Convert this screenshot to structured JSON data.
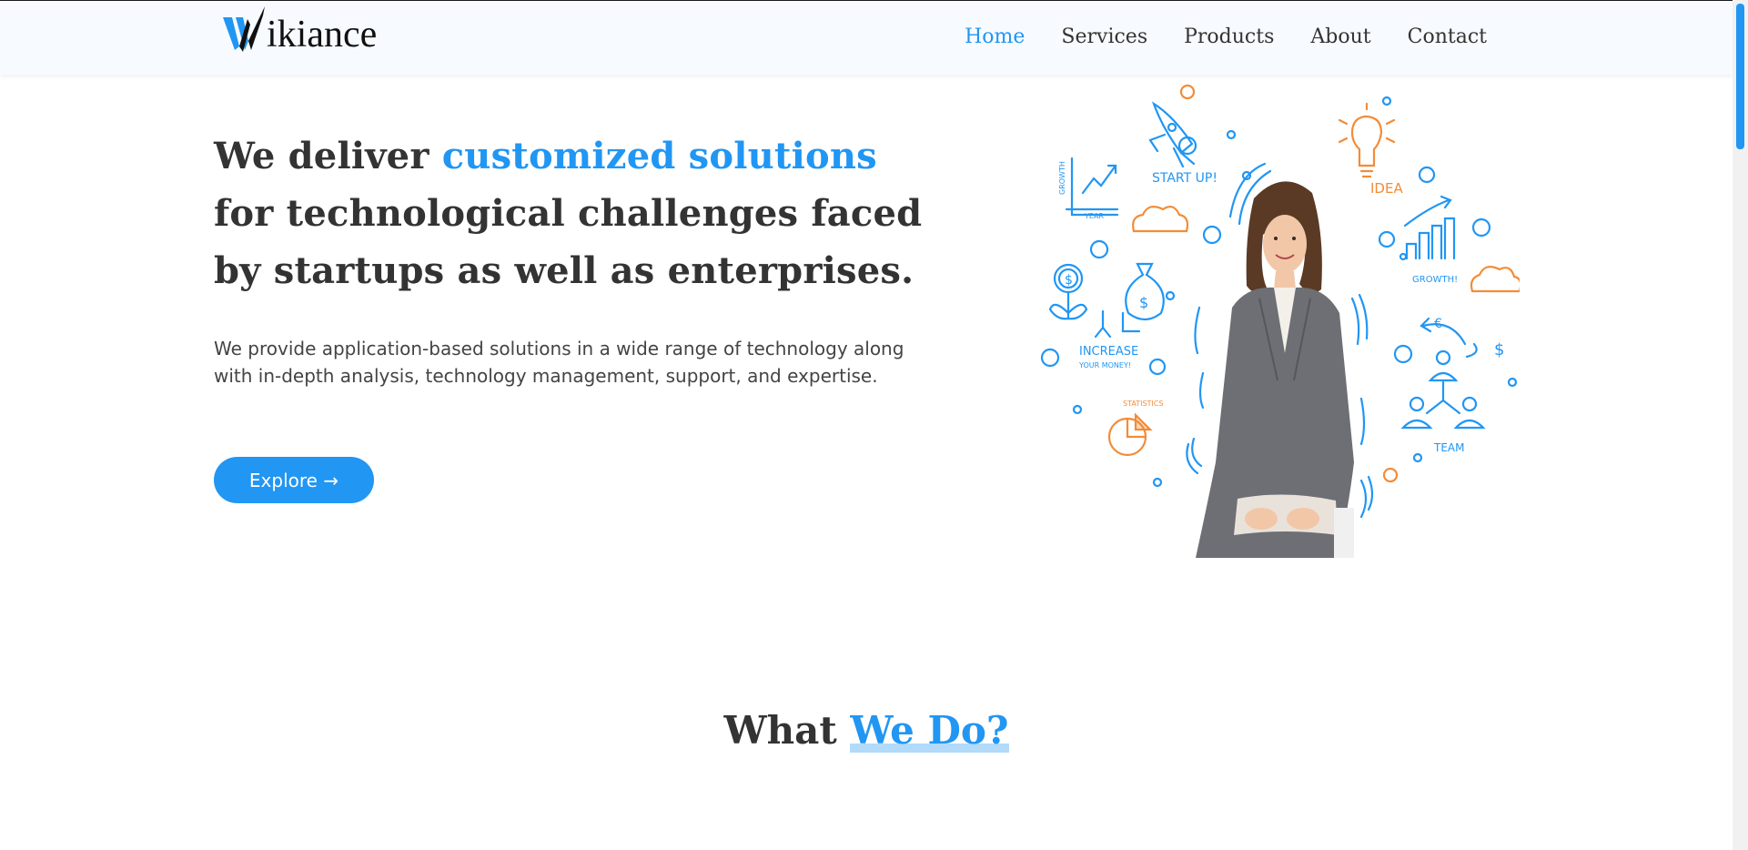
{
  "brand": {
    "name": "ikiance",
    "mark_letter": "W",
    "accent": "#2196f3"
  },
  "nav": {
    "items": [
      {
        "label": "Home",
        "active": true
      },
      {
        "label": "Services",
        "active": false
      },
      {
        "label": "Products",
        "active": false
      },
      {
        "label": "About",
        "active": false
      },
      {
        "label": "Contact",
        "active": false
      }
    ]
  },
  "hero": {
    "title_pre": "We deliver ",
    "title_accent": "customized solutions",
    "title_post": " for technological challenges faced by startups as well as enterprises.",
    "description": "We provide application-based solutions in a wide range of technology along with in-depth analysis, technology management, support, and expertise.",
    "cta_label": "Explore →",
    "illustration_labels": {
      "startup": "START UP!",
      "idea": "IDEA",
      "growth_left": "GROWTH",
      "year": "YEAR",
      "growth_right": "GROWTH!",
      "increase": "INCREASE",
      "your_money": "YOUR MONEY!",
      "statistics": "STATISTICS",
      "team": "TEAM",
      "euro": "€",
      "dollar": "$",
      "bag_dollar": "$",
      "coin_dollar": "$"
    }
  },
  "section": {
    "title_pre": "What ",
    "title_accent": "We Do?"
  }
}
